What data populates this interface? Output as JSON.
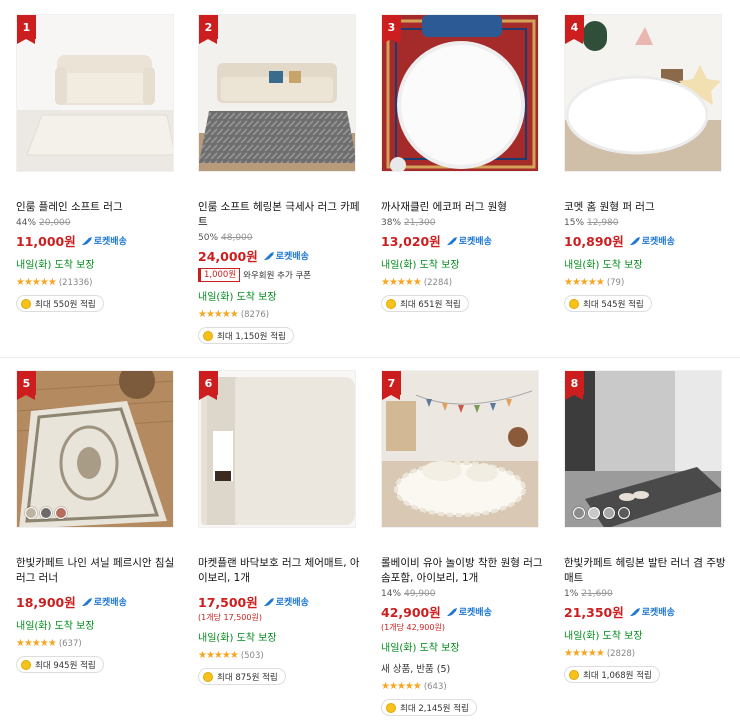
{
  "colors": {
    "price": "#cc1e1e",
    "rocket": "#1e78d2",
    "delivery": "#00891a",
    "star": "#f5a623",
    "rank_badge": "#cc1e1e"
  },
  "rocket_label": "로켓배송",
  "products": [
    {
      "rank": "1",
      "name": "인룸 플레인 소프트 러그",
      "discount": "44%",
      "original_price": "20,000",
      "price": "11,000원",
      "delivery": "내일(화) 도착 보장",
      "rating_stars": "★★★★★",
      "reviews": "(21336)",
      "reward": "최대 550원 적립",
      "image": "cream-sofa-plain-rug"
    },
    {
      "rank": "2",
      "name": "인룸 소프트 헤링본 극세사 러그 카페트",
      "discount": "50%",
      "original_price": "48,000",
      "price": "24,000원",
      "coupon_box": "1,000원",
      "coupon_text": "와우회원 추가 쿠폰",
      "delivery": "내일(화) 도착 보장",
      "rating_stars": "★★★★★",
      "reviews": "(8276)",
      "reward": "최대 1,150원 적립",
      "image": "gray-herringbone-rug"
    },
    {
      "rank": "3",
      "name": "까사재클린 에코퍼 러그 원형",
      "discount": "38%",
      "original_price": "21,300",
      "price": "13,020원",
      "delivery": "내일(화) 도착 보장",
      "rating_stars": "★★★★★",
      "reviews": "(2284)",
      "reward": "최대 651원 적립",
      "image": "white-fur-round-rug"
    },
    {
      "rank": "4",
      "name": "코멧 홈 원형 퍼 러그",
      "discount": "15%",
      "original_price": "12,980",
      "price": "10,890원",
      "delivery": "내일(화) 도착 보장",
      "rating_stars": "★★★★★",
      "reviews": "(79)",
      "reward": "최대 545원 적립",
      "image": "white-fur-round-rug-stars"
    },
    {
      "rank": "5",
      "name": "한빛카페트 나인 셔닐 페르시안 침실 러그 러너",
      "price": "18,900원",
      "delivery": "내일(화) 도착 보장",
      "rating_stars": "★★★★★",
      "reviews": "(637)",
      "reward": "최대 945원 적립",
      "image": "persian-runner-rug"
    },
    {
      "rank": "6",
      "name": "마켓플랜 바닥보호 러그 체어매트, 아이보리, 1개",
      "price": "17,500원",
      "unit_price": "(1개당 17,500원)",
      "delivery": "내일(화) 도착 보장",
      "rating_stars": "★★★★★",
      "reviews": "(503)",
      "reward": "최대 875원 적립",
      "image": "ivory-roll-chair-mat"
    },
    {
      "rank": "7",
      "name": "롤베이비 유아 놀이방 착한 원형 러그 솜포함, 아이보리, 1개",
      "discount": "14%",
      "original_price": "49,900",
      "price": "42,900원",
      "unit_price": "(1개당 42,900원)",
      "delivery": "내일(화) 도착 보장",
      "new_used": "새 상품, 반품 (5)",
      "rating_stars": "★★★★★",
      "reviews": "(643)",
      "reward": "최대 2,145원 적립",
      "image": "baby-round-play-rug"
    },
    {
      "rank": "8",
      "name": "한빛카페트 헤링본 발탄 러너 겸 주방매트",
      "discount": "1%",
      "original_price": "21,690",
      "price": "21,350원",
      "delivery": "내일(화) 도착 보장",
      "rating_stars": "★★★★★",
      "reviews": "(2828)",
      "reward": "최대 1,068원 적립",
      "image": "gray-runner-mat"
    }
  ]
}
